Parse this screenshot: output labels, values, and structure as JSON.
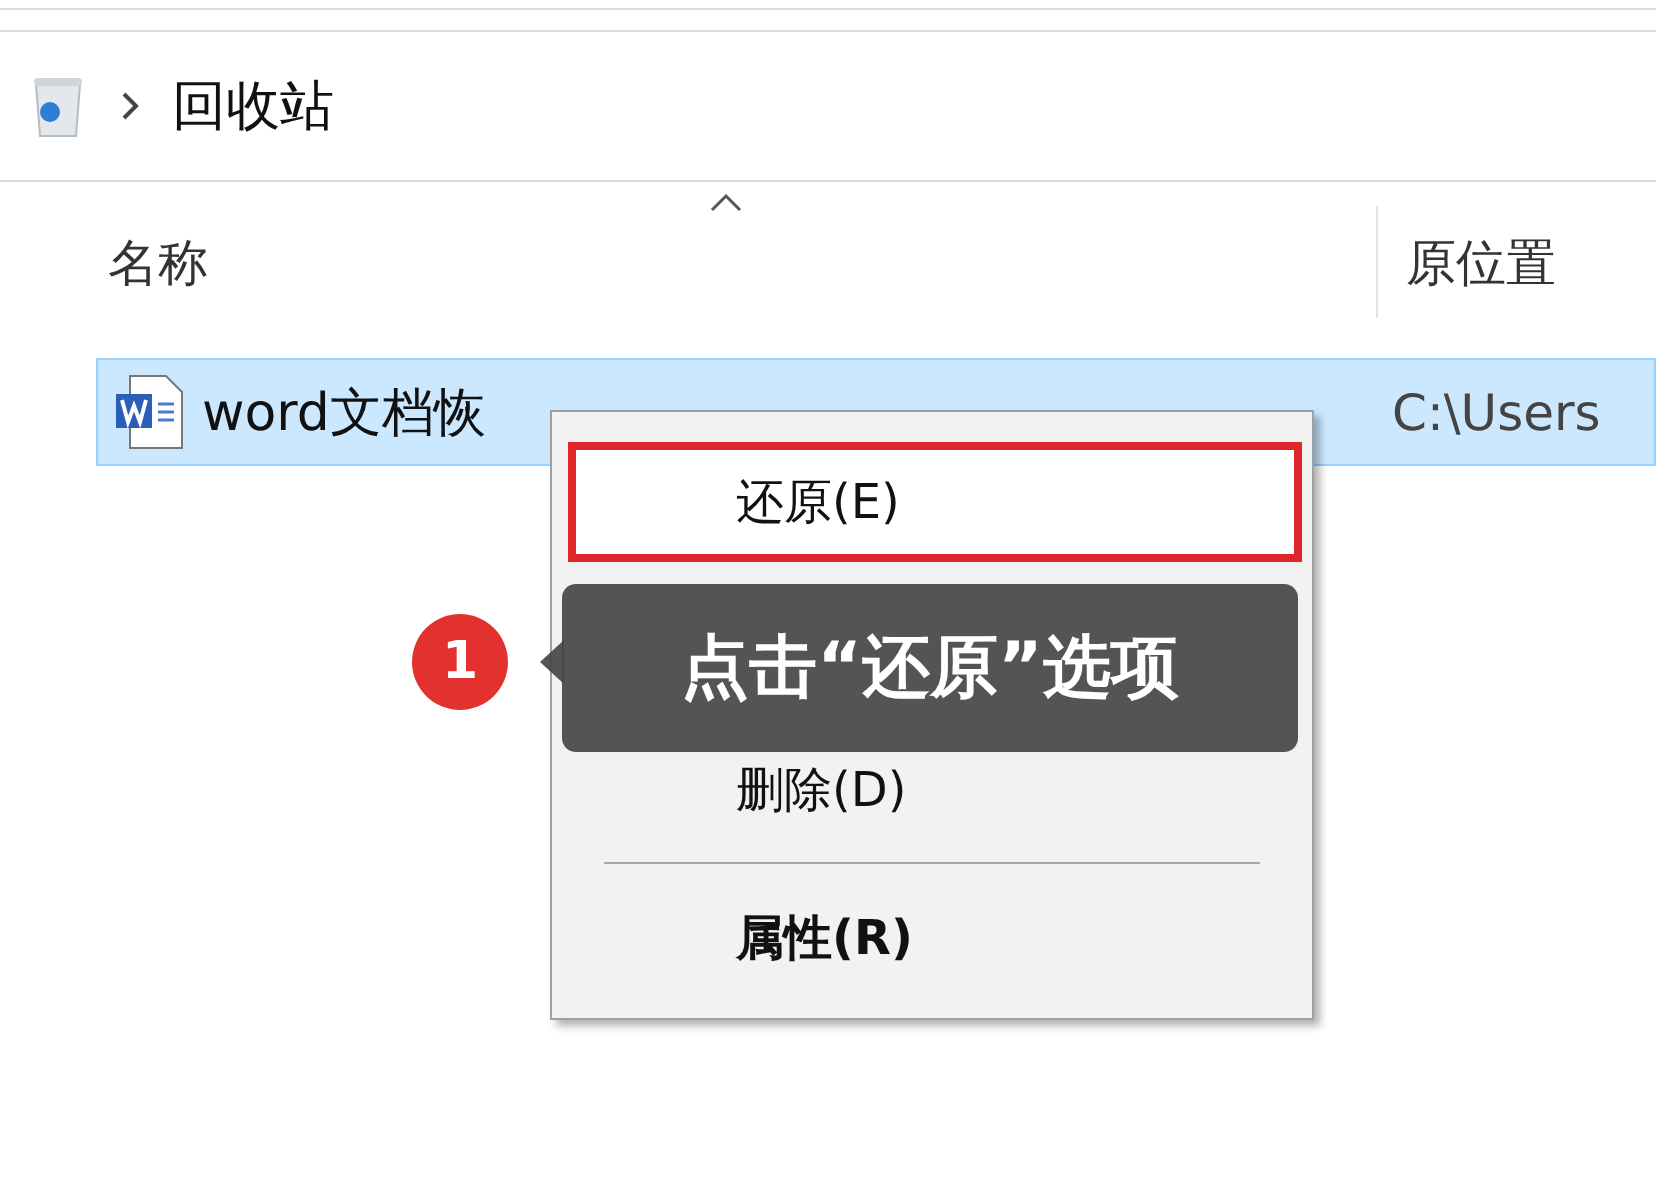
{
  "address_bar": {
    "path": [
      {
        "label": "回收站"
      }
    ]
  },
  "columns": [
    {
      "label": "名称",
      "sorted": true
    },
    {
      "label": "原位置",
      "sorted": false
    }
  ],
  "rows": [
    {
      "name": "word文档恢",
      "location": "C:\\Users",
      "selected": true
    }
  ],
  "context_menu": {
    "items": [
      {
        "kind": "item",
        "label": "还原(E)",
        "highlighted": true,
        "bold": false
      },
      {
        "kind": "covered"
      },
      {
        "kind": "item",
        "label": "删除(D)",
        "highlighted": false,
        "bold": false
      },
      {
        "kind": "separator"
      },
      {
        "kind": "item",
        "label": "属性(R)",
        "highlighted": false,
        "bold": true
      }
    ]
  },
  "callout": {
    "step": "1",
    "text": "点击“还原”选项"
  }
}
